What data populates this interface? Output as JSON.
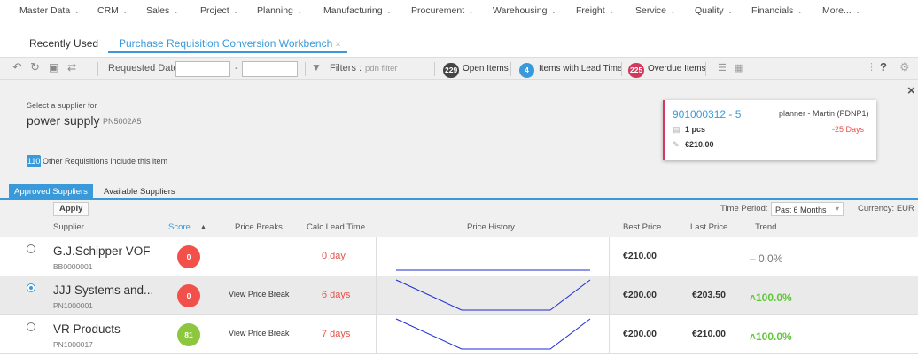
{
  "menu": [
    {
      "label": "Master Data"
    },
    {
      "label": "CRM"
    },
    {
      "label": "Sales"
    },
    {
      "label": "Project"
    },
    {
      "label": "Planning"
    },
    {
      "label": "Manufacturing"
    },
    {
      "label": "Procurement"
    },
    {
      "label": "Warehousing"
    },
    {
      "label": "Freight"
    },
    {
      "label": "Service"
    },
    {
      "label": "Quality"
    },
    {
      "label": "Financials"
    },
    {
      "label": "More..."
    }
  ],
  "tabs": {
    "recent": "Recently Used",
    "active": "Purchase Requisition Conversion Workbench",
    "close": "×"
  },
  "toolbar": {
    "req_date_label": "Requested Date :",
    "dash": "-",
    "filters_label": "Filters :",
    "filter_value": "pdn filter",
    "open_count": "229",
    "open_label": "Open Items",
    "lead_count": "4",
    "lead_label": "Items with Lead Time",
    "overdue_count": "225",
    "overdue_label": "Overdue Items",
    "help": "?"
  },
  "colors": {
    "open": "#444444",
    "lead": "#3a9ad9",
    "overdue": "#d23a5d"
  },
  "panel": {
    "select_text": "Select a supplier for",
    "item_name": "power supply",
    "item_code": "PN5002A5",
    "other_count": "110",
    "other_text": "Other Requisitions include this item",
    "close": "×"
  },
  "card": {
    "req_id": "901000312 - 5",
    "planner": "planner - Martin (PDNP1)",
    "qty": "1 pcs",
    "days": "-25 Days",
    "price": "€210.00"
  },
  "subtabs": {
    "approved": "Approved Suppliers",
    "available": "Available Suppliers"
  },
  "applybar": {
    "apply": "Apply",
    "period_label": "Time Period:",
    "period_value": "Past 6 Months",
    "currency": "Currency:  EUR"
  },
  "headers": {
    "supplier": "Supplier",
    "score": "Score",
    "sort": "▲",
    "price_breaks": "Price Breaks",
    "calc_lead": "Calc Lead Time",
    "history": "Price History",
    "best": "Best Price",
    "last": "Last Price",
    "trend": "Trend"
  },
  "rows": [
    {
      "name": "G.J.Schipper VOF",
      "code": "BB0000001",
      "score": "0",
      "score_color": "#f2504b",
      "price_break": "",
      "lead": "0 day",
      "best": "€210.00",
      "last": "",
      "trend": "– 0.0%",
      "trend_color": "#777777",
      "selected": false,
      "history": [
        210,
        210,
        210
      ]
    },
    {
      "name": "JJJ Systems and...",
      "code": "PN1000001",
      "score": "0",
      "score_color": "#f2504b",
      "price_break": "View Price Break",
      "lead": "6 days",
      "best": "€200.00",
      "last": "€203.50",
      "trend": "˄100.0%",
      "trend_color": "#5fc73a",
      "selected": true,
      "history": [
        210,
        200,
        200,
        210
      ]
    },
    {
      "name": "VR Products",
      "code": "PN1000017",
      "score": "81",
      "score_color": "#8dc73f",
      "price_break": "View Price Break",
      "lead": "7 days",
      "best": "€200.00",
      "last": "€210.00",
      "trend": "˄100.0%",
      "trend_color": "#5fc73a",
      "selected": false,
      "history": [
        210,
        200,
        200,
        210
      ]
    }
  ]
}
